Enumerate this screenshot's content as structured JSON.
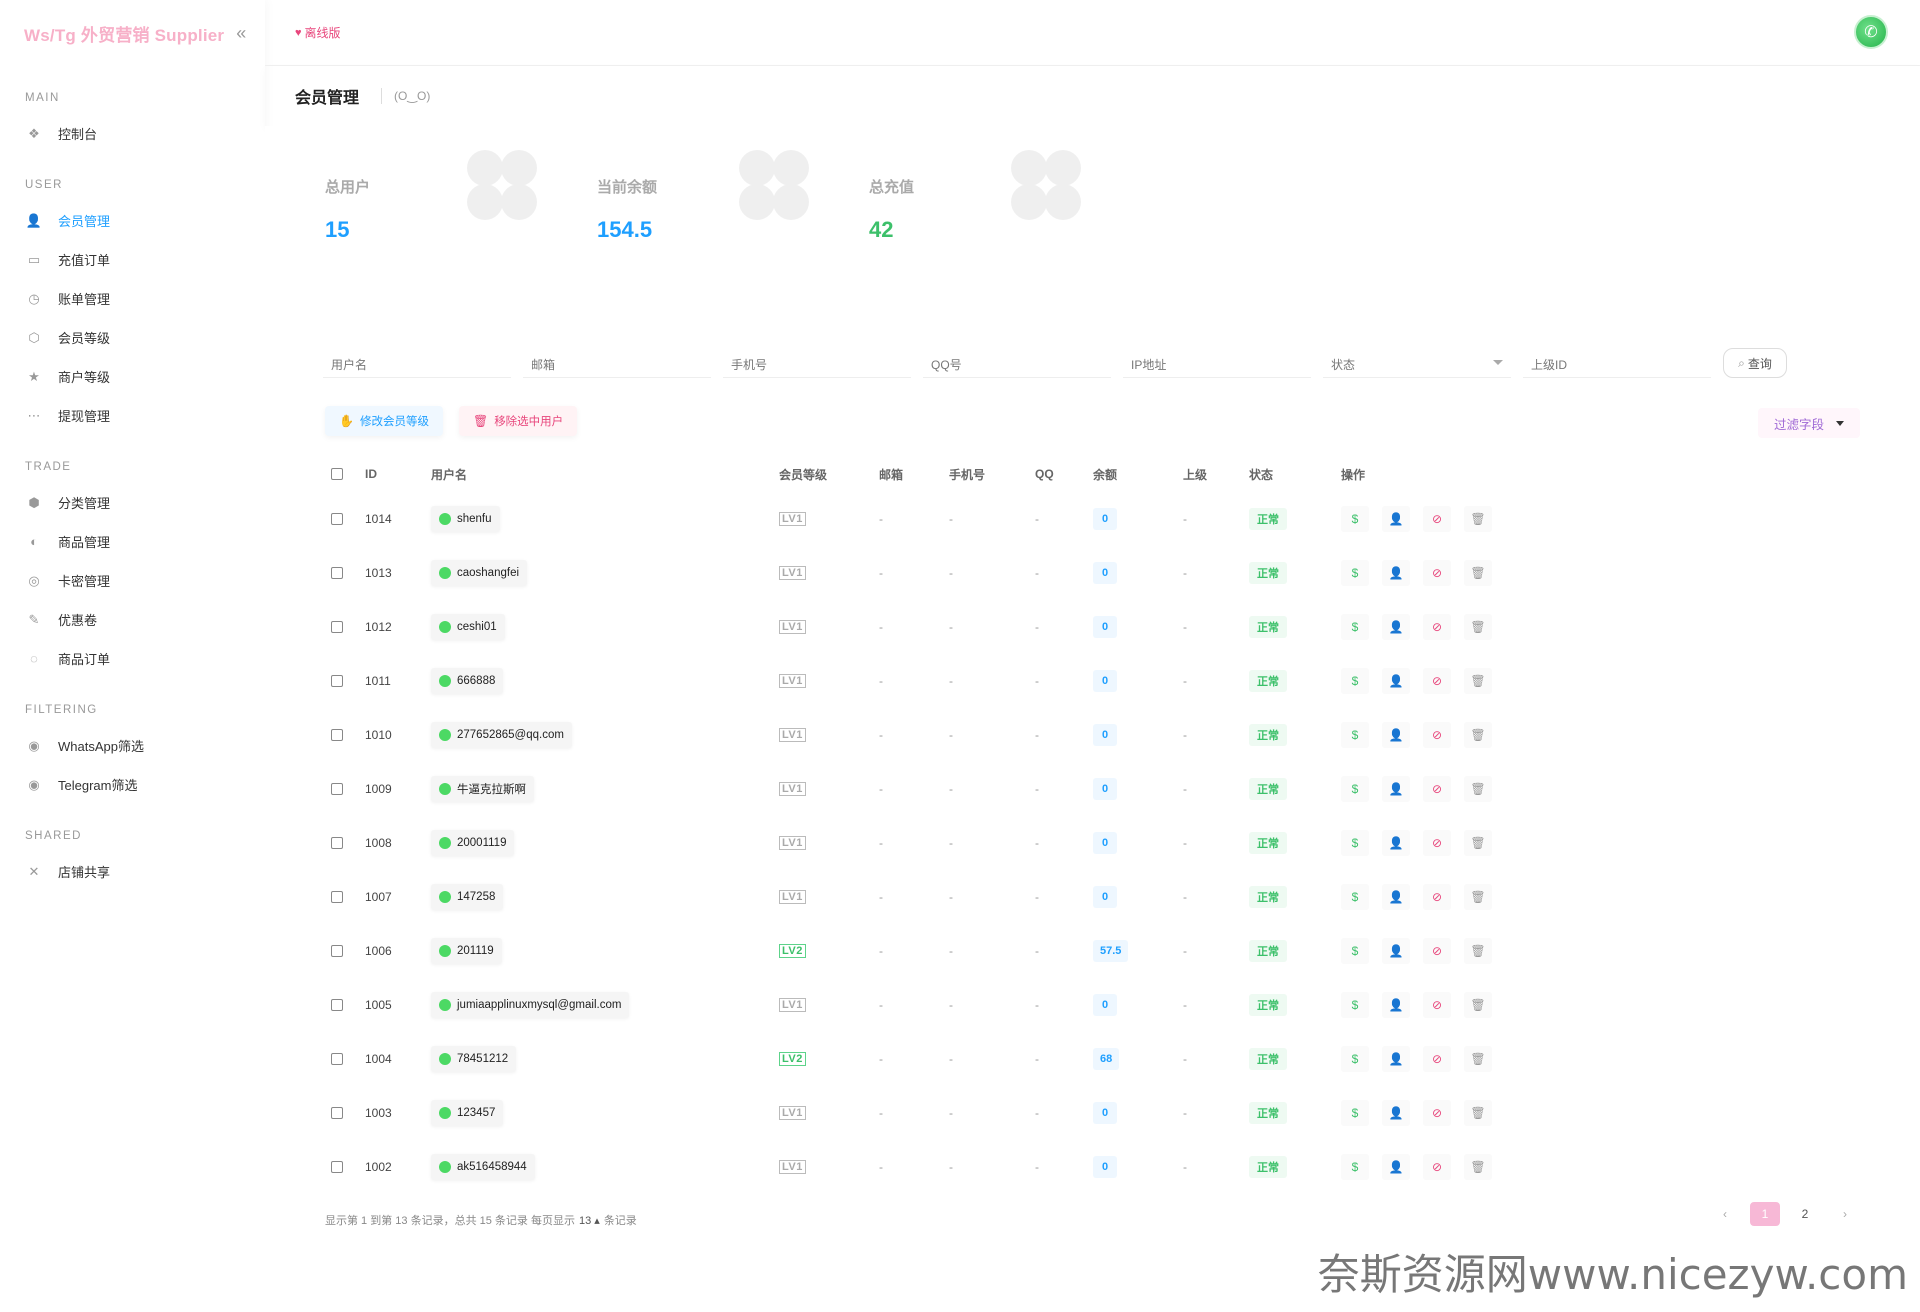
{
  "brand": "Ws/Tg 外贸营销 Supplier",
  "offline_label": "离线版",
  "sidebar": {
    "sections": [
      {
        "title": "MAIN",
        "items": [
          {
            "label": "控制台",
            "icon": "dashboard-icon"
          }
        ]
      },
      {
        "title": "USER",
        "items": [
          {
            "label": "会员管理",
            "icon": "user-icon",
            "active": true
          },
          {
            "label": "充值订单",
            "icon": "recharge-icon"
          },
          {
            "label": "账单管理",
            "icon": "bill-icon"
          },
          {
            "label": "会员等级",
            "icon": "level-icon"
          },
          {
            "label": "商户等级",
            "icon": "star-icon"
          },
          {
            "label": "提现管理",
            "icon": "withdraw-icon"
          }
        ]
      },
      {
        "title": "TRADE",
        "items": [
          {
            "label": "分类管理",
            "icon": "category-icon"
          },
          {
            "label": "商品管理",
            "icon": "goods-icon"
          },
          {
            "label": "卡密管理",
            "icon": "card-icon"
          },
          {
            "label": "优惠卷",
            "icon": "coupon-icon"
          },
          {
            "label": "商品订单",
            "icon": "order-icon"
          }
        ]
      },
      {
        "title": "FILTERING",
        "items": [
          {
            "label": "WhatsApp筛选",
            "icon": "whatsapp-icon"
          },
          {
            "label": "Telegram筛选",
            "icon": "telegram-icon"
          }
        ]
      },
      {
        "title": "SHARED",
        "items": [
          {
            "label": "店铺共享",
            "icon": "share-icon"
          }
        ]
      }
    ]
  },
  "page": {
    "title": "会员管理",
    "subtitle": "(O‿O)"
  },
  "stats": [
    {
      "label": "总用户",
      "value": "15",
      "color": "#1e9fff"
    },
    {
      "label": "当前余额",
      "value": "154.5",
      "color": "#1e9fff"
    },
    {
      "label": "总充值",
      "value": "42",
      "color": "#3cc06a"
    }
  ],
  "filters": [
    {
      "placeholder": "用户名"
    },
    {
      "placeholder": "邮箱"
    },
    {
      "placeholder": "手机号"
    },
    {
      "placeholder": "QQ号"
    },
    {
      "placeholder": "IP地址"
    },
    {
      "placeholder": "状态",
      "select": true
    },
    {
      "placeholder": "上级ID"
    }
  ],
  "query_label": "查询",
  "actions": {
    "modify_level": "修改会员等级",
    "remove_selected": "移除选中用户",
    "filter_fields": "过滤字段"
  },
  "table": {
    "headers": [
      "ID",
      "用户名",
      "会员等级",
      "邮箱",
      "手机号",
      "QQ",
      "余额",
      "上级",
      "状态",
      "操作"
    ],
    "rows": [
      {
        "id": "1014",
        "user": "shenfu",
        "level": "LV1",
        "email": "-",
        "phone": "-",
        "qq": "-",
        "balance": "0",
        "parent": "-",
        "status": "正常"
      },
      {
        "id": "1013",
        "user": "caoshangfei",
        "level": "LV1",
        "email": "-",
        "phone": "-",
        "qq": "-",
        "balance": "0",
        "parent": "-",
        "status": "正常"
      },
      {
        "id": "1012",
        "user": "ceshi01",
        "level": "LV1",
        "email": "-",
        "phone": "-",
        "qq": "-",
        "balance": "0",
        "parent": "-",
        "status": "正常"
      },
      {
        "id": "1011",
        "user": "666888",
        "level": "LV1",
        "email": "-",
        "phone": "-",
        "qq": "-",
        "balance": "0",
        "parent": "-",
        "status": "正常"
      },
      {
        "id": "1010",
        "user": "277652865@qq.com",
        "level": "LV1",
        "email": "-",
        "phone": "-",
        "qq": "-",
        "balance": "0",
        "parent": "-",
        "status": "正常"
      },
      {
        "id": "1009",
        "user": "牛逼克拉斯啊",
        "level": "LV1",
        "email": "-",
        "phone": "-",
        "qq": "-",
        "balance": "0",
        "parent": "-",
        "status": "正常"
      },
      {
        "id": "1008",
        "user": "20001119",
        "level": "LV1",
        "email": "-",
        "phone": "-",
        "qq": "-",
        "balance": "0",
        "parent": "-",
        "status": "正常"
      },
      {
        "id": "1007",
        "user": "147258",
        "level": "LV1",
        "email": "-",
        "phone": "-",
        "qq": "-",
        "balance": "0",
        "parent": "-",
        "status": "正常"
      },
      {
        "id": "1006",
        "user": "201119",
        "level": "LV2",
        "email": "-",
        "phone": "-",
        "qq": "-",
        "balance": "57.5",
        "parent": "-",
        "status": "正常"
      },
      {
        "id": "1005",
        "user": "jumiaapplinuxmysql@gmail.com",
        "level": "LV1",
        "email": "-",
        "phone": "-",
        "qq": "-",
        "balance": "0",
        "parent": "-",
        "status": "正常"
      },
      {
        "id": "1004",
        "user": "78451212",
        "level": "LV2",
        "email": "-",
        "phone": "-",
        "qq": "-",
        "balance": "68",
        "parent": "-",
        "status": "正常"
      },
      {
        "id": "1003",
        "user": "123457",
        "level": "LV1",
        "email": "-",
        "phone": "-",
        "qq": "-",
        "balance": "0",
        "parent": "-",
        "status": "正常"
      },
      {
        "id": "1002",
        "user": "ak516458944",
        "level": "LV1",
        "email": "-",
        "phone": "-",
        "qq": "-",
        "balance": "0",
        "parent": "-",
        "status": "正常"
      }
    ]
  },
  "footer": {
    "info_prefix": "显示第 1 到第 13 条记录，总共 15 条记录  每页显示",
    "per_page": "13",
    "info_suffix": "条记录"
  },
  "pagination": {
    "prev": "‹",
    "pages": [
      "1",
      "2"
    ],
    "current": "1",
    "next": "›"
  },
  "watermark": "奈斯资源网www.nicezyw.com"
}
